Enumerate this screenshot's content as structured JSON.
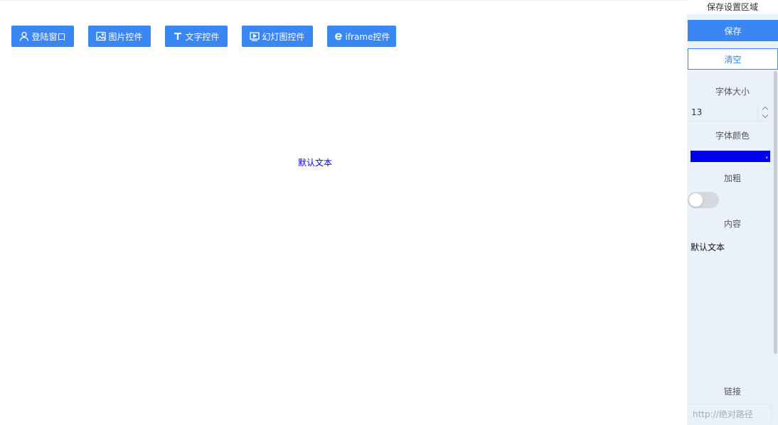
{
  "toolbar": {
    "buttons": [
      {
        "label": "登陆窗口",
        "icon": "user-icon"
      },
      {
        "label": "图片控件",
        "icon": "image-icon"
      },
      {
        "label": "文字控件",
        "icon": "text-icon"
      },
      {
        "label": "幻灯图控件",
        "icon": "slideshow-icon"
      },
      {
        "label": "iframe控件",
        "icon": "browser-icon"
      }
    ]
  },
  "canvas": {
    "text": "默认文本",
    "text_color": "#0000ee"
  },
  "panel": {
    "title": "保存设置区域",
    "save_label": "保存",
    "clear_label": "清空",
    "font_size_label": "字体大小",
    "font_size_value": "13",
    "font_color_label": "字体颜色",
    "font_color_value": "#0000ee",
    "bold_label": "加粗",
    "bold_on": false,
    "content_label": "内容",
    "content_value": "默认文本",
    "link_label": "链接",
    "link_placeholder": "http://绝对路径"
  },
  "colors": {
    "accent": "#3a86f3",
    "panel_bg": "#eaf1fb"
  }
}
